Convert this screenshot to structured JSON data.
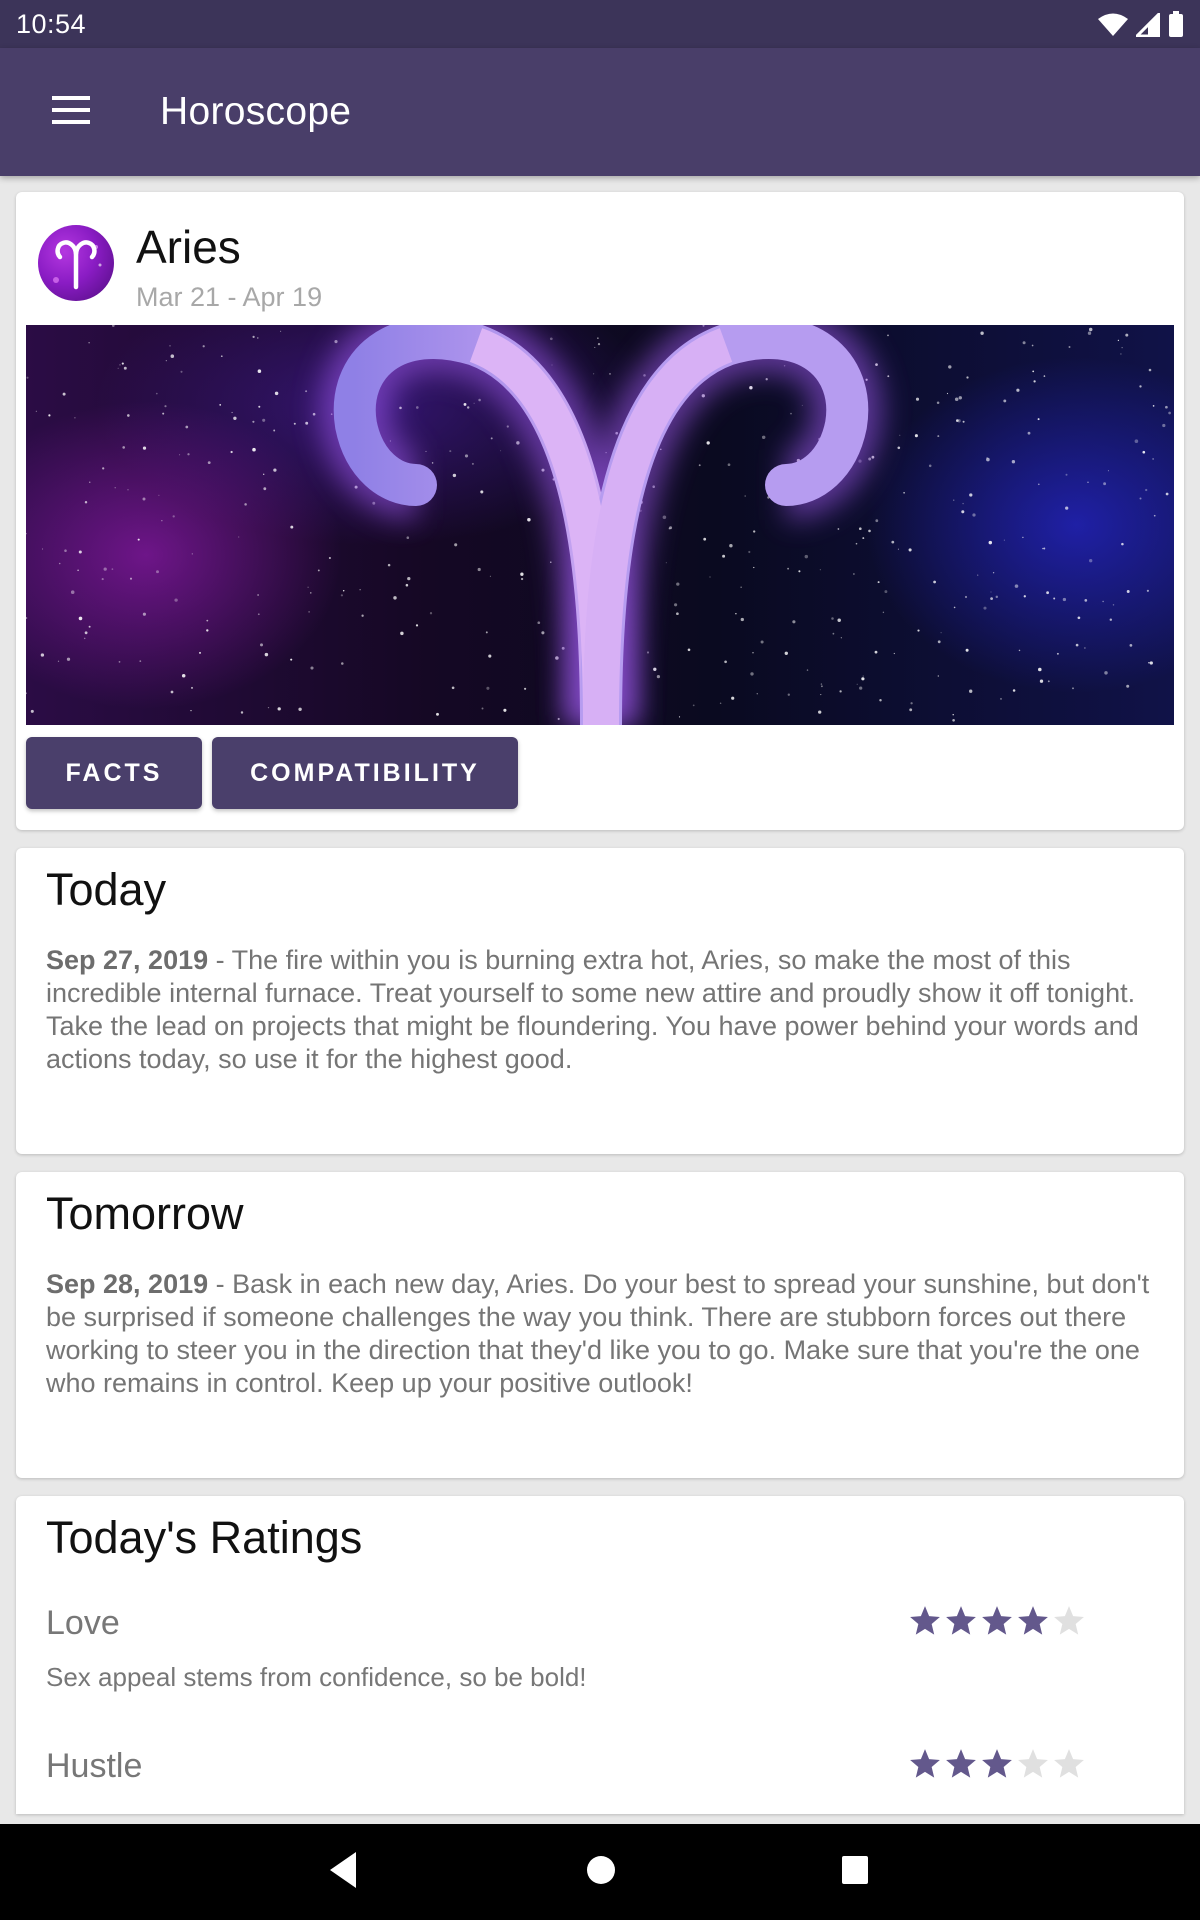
{
  "status_bar": {
    "time": "10:54",
    "icons": [
      "wifi-icon",
      "signal-icon",
      "battery-icon"
    ]
  },
  "app_bar": {
    "title": "Horoscope",
    "menu_icon": "hamburger-menu-icon"
  },
  "sign": {
    "name": "Aries",
    "dates": "Mar 21 - Apr 19",
    "icon": "aries-symbol-icon",
    "buttons": {
      "facts": "FACTS",
      "compatibility": "COMPATIBILITY"
    }
  },
  "today": {
    "title": "Today",
    "date": "Sep 27, 2019",
    "text": " - The fire within you is burning extra hot, Aries, so make the most of this incredible internal furnace. Treat yourself to some new attire and proudly show it off tonight. Take the lead on projects that might be floundering. You have power behind your words and actions today, so use it for the highest good."
  },
  "tomorrow": {
    "title": "Tomorrow",
    "date": "Sep 28, 2019",
    "text": " - Bask in each new day, Aries. Do your best to spread your sunshine, but don't be surprised if someone challenges the way you think. There are stubborn forces out there working to steer you in the direction that they'd like you to go. Make sure that you're the one who remains in control. Keep up your positive outlook!"
  },
  "ratings": {
    "title": "Today's Ratings",
    "max_stars": 5,
    "items": [
      {
        "label": "Love",
        "stars": 4,
        "description": "Sex appeal stems from confidence, so be bold!"
      },
      {
        "label": "Hustle",
        "stars": 3,
        "description": ""
      }
    ]
  },
  "colors": {
    "primary": "#493e69",
    "primary_dark": "#3c3459",
    "star_filled": "#63588c",
    "star_empty": "#e0e0e0"
  },
  "nav_bar": {
    "buttons": [
      "back-icon",
      "home-icon",
      "recents-icon"
    ]
  }
}
